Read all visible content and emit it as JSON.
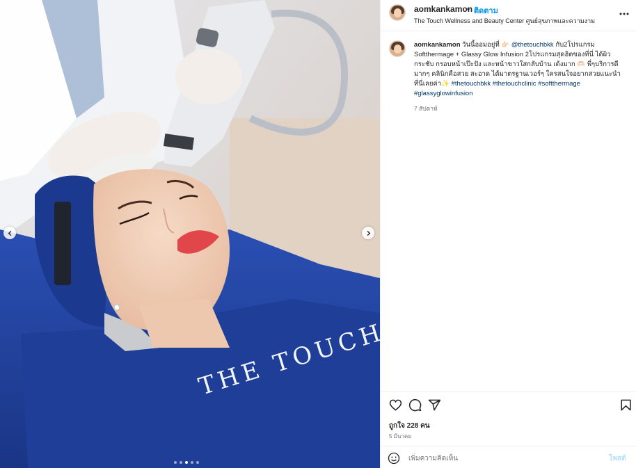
{
  "header": {
    "username": "aomkankamon",
    "separator": "•",
    "follow_label": "ติดตาม",
    "location": "The Touch Wellness and Beauty Center ศูนย์สุขภาพและความงาม",
    "more_icon": "more-horizontal-icon"
  },
  "media": {
    "brand_text": "THE TOUCH",
    "prev_icon": "chevron-left-icon",
    "next_icon": "chevron-right-icon",
    "slide_count": 5,
    "active_slide": 3
  },
  "caption": {
    "username": "aomkankamon",
    "text_1": "วันนี้ออมอยู่ที่ 👉🏻 ",
    "mention": "@thetouchbkk",
    "text_2": " กับ2โปรแกรม Softthermage + Glassy Glow Infusion 2โปรแกรมสุดฮิตของที่นี่ ได้ผิวกระชับ กรอบหน้าเป๊ะปัง และหน้าขาวใสกลับบ้าน เด้งมาก 🫶🏻 พี่ๆบริการดีมากๆ คลินิกคือสวย สะอาด ได้มาตรฐานเวอร์ๆ ใครสนใจอยากสวยแนะนำที่นี่เลยค่า✨ ",
    "tags": "#thetouchbkk #thetouchclinic #softthermage #glassyglowinfusion",
    "time": "7 สัปดาห์"
  },
  "actions": {
    "like_icon": "heart-icon",
    "comment_icon": "comment-icon",
    "share_icon": "share-icon",
    "save_icon": "bookmark-icon",
    "likes_label": "ถูกใจ 228 คน",
    "date": "5 มีนาคม"
  },
  "comment_box": {
    "emoji_icon": "emoji-icon",
    "placeholder": "เพิ่มความคิดเห็น",
    "post_label": "โพสต์"
  },
  "colors": {
    "link": "#0095f6",
    "hashtag": "#00376b",
    "secondary_text": "#737373",
    "border": "#efefef",
    "gown_blue": "#1e3f9a"
  }
}
